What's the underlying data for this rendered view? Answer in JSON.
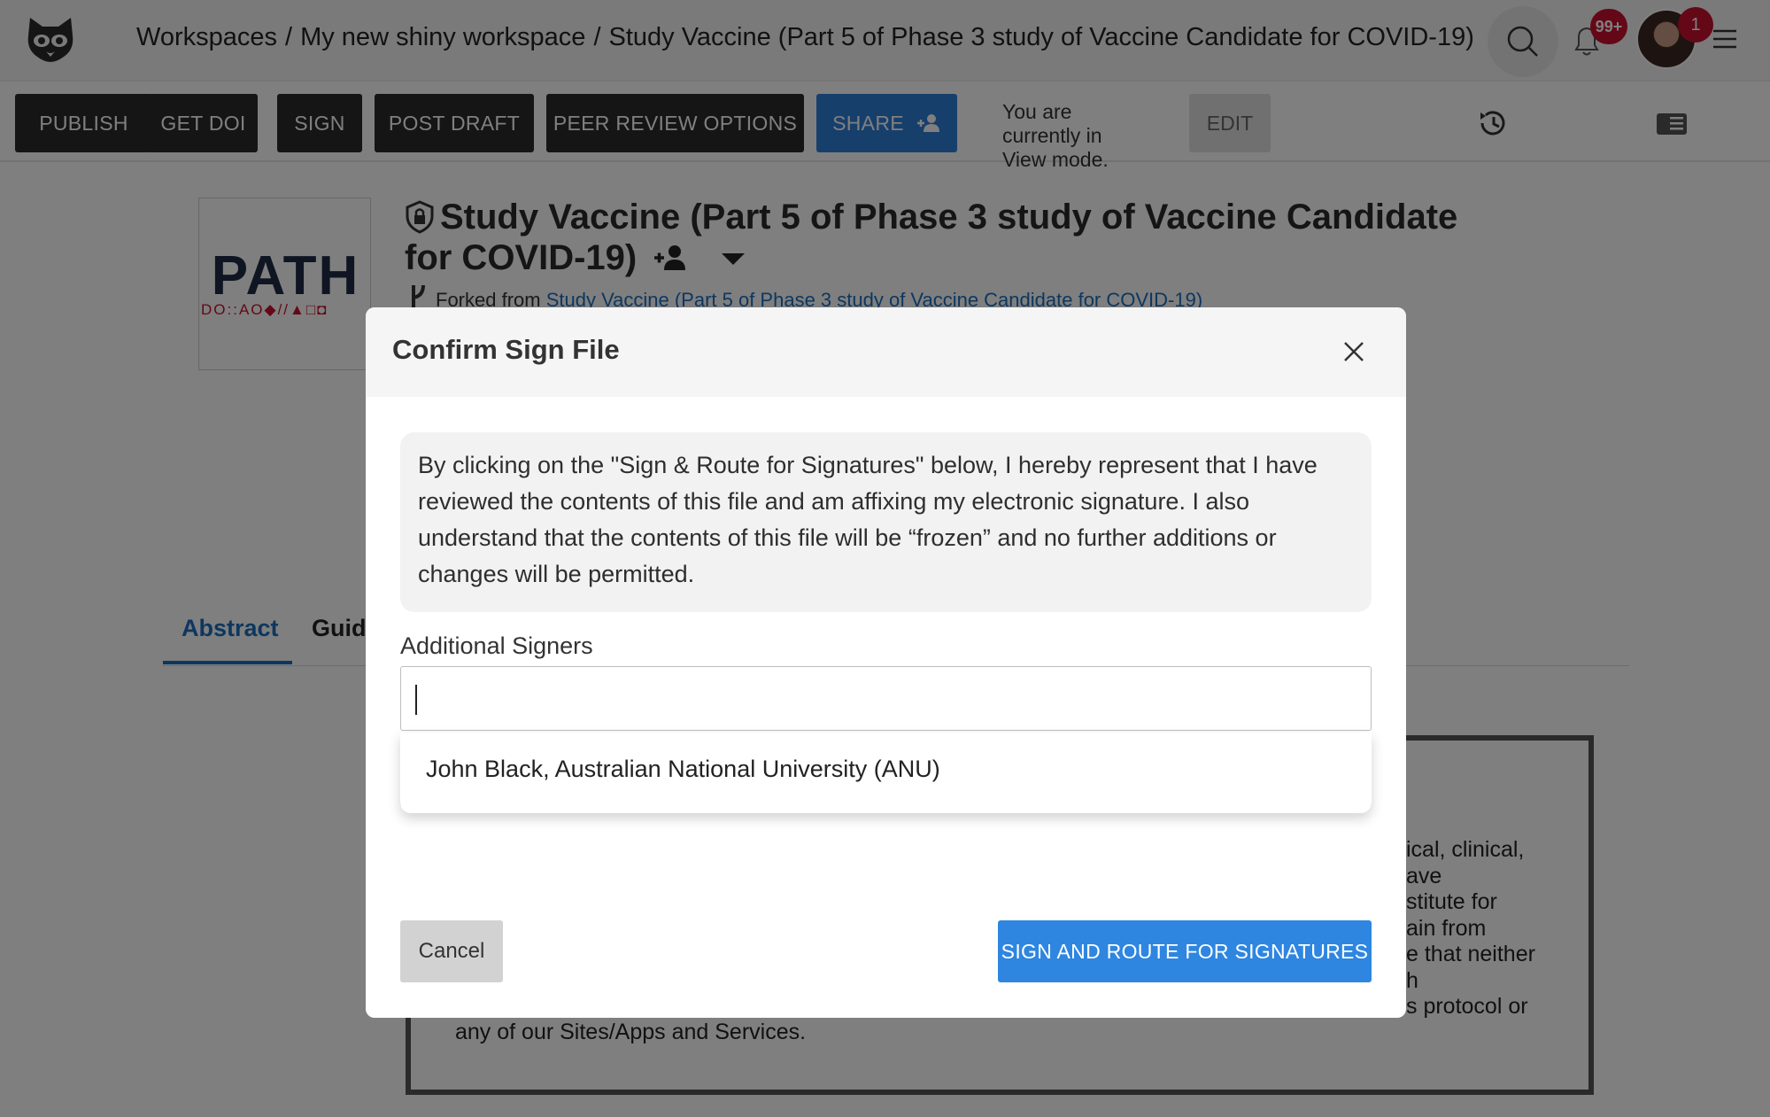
{
  "header": {
    "breadcrumbs": [
      "Workspaces",
      "My new shiny workspace",
      "Study Vaccine (Part 5 of Phase 3 study of Vaccine Candidate for COVID-19)"
    ],
    "breadcrumb_separator": "/",
    "notifications_badge": "99+",
    "user_badge": "1"
  },
  "toolbar": {
    "publish": "PUBLISH",
    "get_doi": "GET DOI",
    "sign": "SIGN",
    "post_draft": "POST DRAFT",
    "peer_review": "PEER REVIEW OPTIONS",
    "share": "SHARE",
    "mode_text": "You are currently in View mode.",
    "edit": "EDIT"
  },
  "document": {
    "thumbnail_text": "PATH",
    "thumbnail_marks": "DO::AO◆//▲□◘",
    "title": "Study Vaccine (Part 5 of Phase 3 study of Vaccine Candidate for COVID-19)",
    "forked_prefix": "Forked from",
    "forked_link": "Study Vaccine (Part 5 of Phase 3 study of Vaccine Candidate for COVID-19)"
  },
  "tabs": [
    "Abstract",
    "Guide"
  ],
  "abstract_visible": {
    "right_lines": [
      "ical, clinical,",
      "ave",
      "stitute for",
      "ain from",
      "e that neither",
      "h",
      "s protocol or"
    ],
    "bottom_line": "any of our Sites/Apps and Services."
  },
  "modal": {
    "title": "Confirm Sign File",
    "notice": "By clicking on the \"Sign & Route for Signatures\" below, I hereby represent that I have reviewed the contents of this file and am affixing my electronic signature. I also understand that the contents of this file will be “frozen” and no further additions or changes will be permitted.",
    "signers_label": "Additional Signers",
    "signers_value": "",
    "suggestions": [
      "John Black, Australian National University (ANU)"
    ],
    "cancel": "Cancel",
    "confirm": "SIGN AND ROUTE FOR SIGNATURES"
  },
  "colors": {
    "primary": "#2e86e0",
    "dark_button": "#2b2b2b",
    "link": "#1d6fbf",
    "badge": "#c8102e"
  },
  "icons": [
    "raccoon-logo-icon",
    "search-icon",
    "bell-icon",
    "menu-icon",
    "person-add-icon",
    "history-icon",
    "panel-icon",
    "shield-icon",
    "caret-down-icon",
    "fork-icon",
    "close-icon"
  ]
}
